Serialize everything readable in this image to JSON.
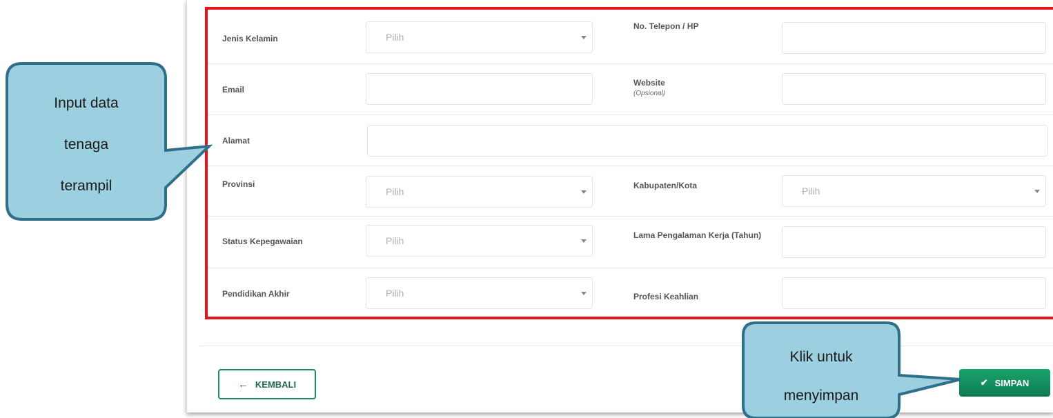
{
  "form": {
    "select_placeholder": "Pilih",
    "labels": {
      "jenis_kelamin": "Jenis Kelamin",
      "no_telepon": "No. Telepon / HP",
      "email": "Email",
      "website": "Website",
      "website_hint": "(Opsional)",
      "alamat": "Alamat",
      "provinsi": "Provinsi",
      "kabupaten": "Kabupaten/Kota",
      "status_kepegawaian": "Status Kepegawaian",
      "lama_pengalaman": "Lama Pengalaman Kerja (Tahun)",
      "pendidikan_akhir": "Pendidikan Akhir",
      "profesi_keahlian": "Profesi Keahlian"
    }
  },
  "buttons": {
    "back_label": "KEMBALI",
    "save_label": "SIMPAN"
  },
  "callouts": {
    "left_line1": "Input data",
    "left_line2": "tenaga",
    "left_line3": "terampil",
    "right_line1": "Klik untuk",
    "right_line2": "menyimpan"
  },
  "colors": {
    "highlight_border": "#e5141a",
    "callout_fill": "#9ccfe0",
    "callout_border": "#2f6f8a",
    "primary_green": "#1aa36e"
  }
}
